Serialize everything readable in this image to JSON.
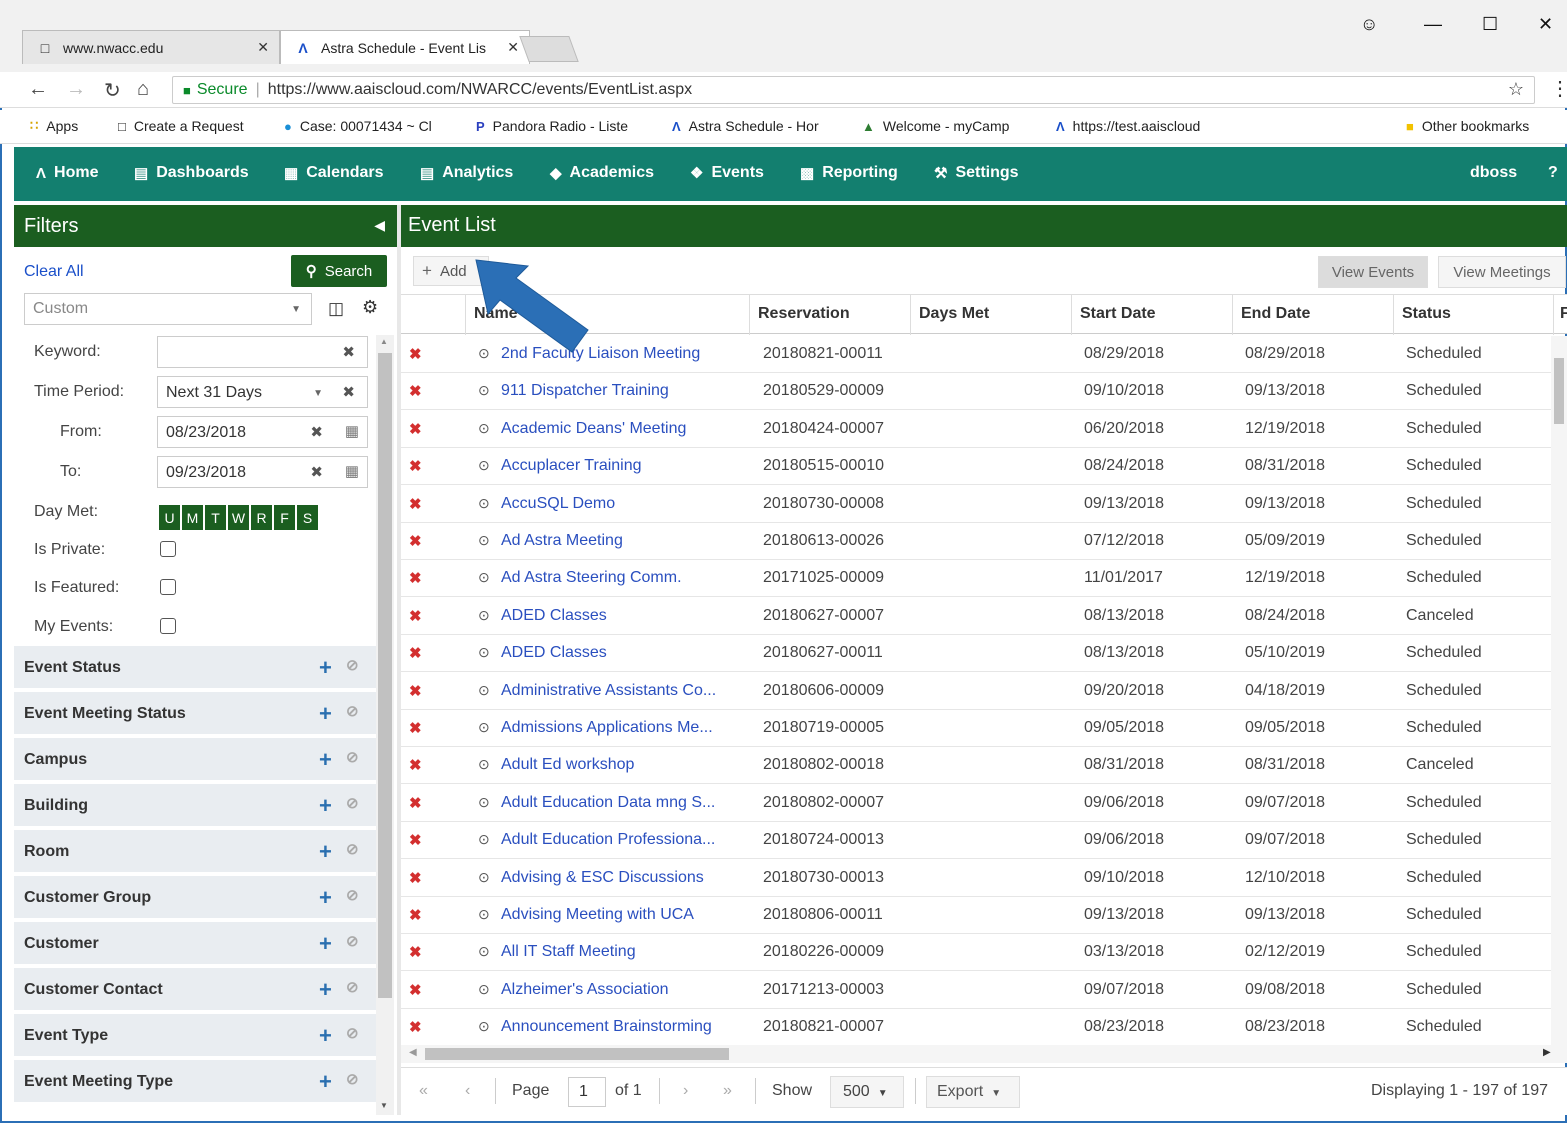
{
  "browser": {
    "tabs": [
      {
        "label": "www.nwacc.edu",
        "icon": "page-icon"
      },
      {
        "label": "Astra Schedule - Event Lis",
        "icon": "astra-icon"
      }
    ],
    "secure_label": "Secure",
    "url": "https://www.aaiscloud.com/NWARCC/events/EventList.aspx",
    "bookmarks": [
      {
        "label": "Apps",
        "icon": "apps-grid-icon"
      },
      {
        "label": "Create a Request",
        "icon": "page-icon"
      },
      {
        "label": "Case: 00071434 ~ Cl",
        "icon": "salesforce-cloud-icon"
      },
      {
        "label": "Pandora Radio - Liste",
        "icon": "pandora-icon"
      },
      {
        "label": "Astra Schedule - Hor",
        "icon": "astra-icon"
      },
      {
        "label": "Welcome - myCamp",
        "icon": "tree-icon"
      },
      {
        "label": "https://test.aaiscloud",
        "icon": "astra-icon"
      }
    ],
    "other_bookmarks": "Other bookmarks"
  },
  "appnav": {
    "items": [
      {
        "label": "Home",
        "icon": "astra-icon"
      },
      {
        "label": "Dashboards",
        "icon": "bar-chart-icon"
      },
      {
        "label": "Calendars",
        "icon": "calendar-icon"
      },
      {
        "label": "Analytics",
        "icon": "bar-chart-icon"
      },
      {
        "label": "Academics",
        "icon": "graduation-cap-icon"
      },
      {
        "label": "Events",
        "icon": "tag-icon"
      },
      {
        "label": "Reporting",
        "icon": "document-icon"
      },
      {
        "label": "Settings",
        "icon": "wrench-icon"
      }
    ],
    "user": "dboss",
    "help": "?"
  },
  "filters": {
    "title": "Filters",
    "clear_all": "Clear All",
    "search": "Search",
    "preset": "Custom",
    "keyword_label": "Keyword:",
    "keyword_value": "",
    "time_period_label": "Time Period:",
    "time_period_value": "Next 31 Days",
    "from_label": "From:",
    "from_value": "08/23/2018",
    "to_label": "To:",
    "to_value": "09/23/2018",
    "day_met_label": "Day Met:",
    "days": [
      "U",
      "M",
      "T",
      "W",
      "R",
      "F",
      "S"
    ],
    "is_private_label": "Is Private:",
    "is_featured_label": "Is Featured:",
    "my_events_label": "My Events:",
    "sections": [
      "Event Status",
      "Event Meeting Status",
      "Campus",
      "Building",
      "Room",
      "Customer Group",
      "Customer",
      "Customer Contact",
      "Event Type",
      "Event Meeting Type"
    ]
  },
  "eventlist": {
    "title": "Event List",
    "add": "Add",
    "view_events": "View Events",
    "view_meetings": "View Meetings",
    "columns": [
      "Name",
      "Reservation",
      "Days Met",
      "Start Date",
      "End Date",
      "Status",
      "F"
    ],
    "rows": [
      {
        "name": "2nd Faculty Liaison Meeting",
        "reservation": "20180821-00011",
        "start": "08/29/2018",
        "end": "08/29/2018",
        "status": "Scheduled"
      },
      {
        "name": "911 Dispatcher Training",
        "reservation": "20180529-00009",
        "start": "09/10/2018",
        "end": "09/13/2018",
        "status": "Scheduled"
      },
      {
        "name": "Academic Deans' Meeting",
        "reservation": "20180424-00007",
        "start": "06/20/2018",
        "end": "12/19/2018",
        "status": "Scheduled"
      },
      {
        "name": "Accuplacer Training",
        "reservation": "20180515-00010",
        "start": "08/24/2018",
        "end": "08/31/2018",
        "status": "Scheduled"
      },
      {
        "name": "AccuSQL Demo",
        "reservation": "20180730-00008",
        "start": "09/13/2018",
        "end": "09/13/2018",
        "status": "Scheduled"
      },
      {
        "name": "Ad Astra Meeting",
        "reservation": "20180613-00026",
        "start": "07/12/2018",
        "end": "05/09/2019",
        "status": "Scheduled"
      },
      {
        "name": "Ad Astra Steering Comm.",
        "reservation": "20171025-00009",
        "start": "11/01/2017",
        "end": "12/19/2018",
        "status": "Scheduled"
      },
      {
        "name": "ADED Classes",
        "reservation": "20180627-00007",
        "start": "08/13/2018",
        "end": "08/24/2018",
        "status": "Canceled"
      },
      {
        "name": "ADED Classes",
        "reservation": "20180627-00011",
        "start": "08/13/2018",
        "end": "05/10/2019",
        "status": "Scheduled"
      },
      {
        "name": "Administrative Assistants Co...",
        "reservation": "20180606-00009",
        "start": "09/20/2018",
        "end": "04/18/2019",
        "status": "Scheduled"
      },
      {
        "name": "Admissions Applications Me...",
        "reservation": "20180719-00005",
        "start": "09/05/2018",
        "end": "09/05/2018",
        "status": "Scheduled"
      },
      {
        "name": "Adult Ed workshop",
        "reservation": "20180802-00018",
        "start": "08/31/2018",
        "end": "08/31/2018",
        "status": "Canceled"
      },
      {
        "name": "Adult Education Data mng S...",
        "reservation": "20180802-00007",
        "start": "09/06/2018",
        "end": "09/07/2018",
        "status": "Scheduled"
      },
      {
        "name": "Adult Education Professiona...",
        "reservation": "20180724-00013",
        "start": "09/06/2018",
        "end": "09/07/2018",
        "status": "Scheduled"
      },
      {
        "name": "Advising & ESC Discussions",
        "reservation": "20180730-00013",
        "start": "09/10/2018",
        "end": "12/10/2018",
        "status": "Scheduled"
      },
      {
        "name": "Advising Meeting with UCA",
        "reservation": "20180806-00011",
        "start": "09/13/2018",
        "end": "09/13/2018",
        "status": "Scheduled"
      },
      {
        "name": "All IT Staff Meeting",
        "reservation": "20180226-00009",
        "start": "03/13/2018",
        "end": "02/12/2019",
        "status": "Scheduled"
      },
      {
        "name": "Alzheimer's Association",
        "reservation": "20171213-00003",
        "start": "09/07/2018",
        "end": "09/08/2018",
        "status": "Scheduled"
      },
      {
        "name": "Announcement Brainstorming",
        "reservation": "20180821-00007",
        "start": "08/23/2018",
        "end": "08/23/2018",
        "status": "Scheduled"
      }
    ],
    "pager": {
      "page_label": "Page",
      "page": "1",
      "of": "of 1",
      "show_label": "Show",
      "show_value": "500",
      "export": "Export",
      "displaying": "Displaying 1 - 197 of 197"
    }
  },
  "colors": {
    "navbar": "#137f6f",
    "panel_header": "#1b5e20",
    "link": "#2a4fbf",
    "delete": "#d32f2f",
    "annotation_arrow": "#2b6fb6"
  }
}
